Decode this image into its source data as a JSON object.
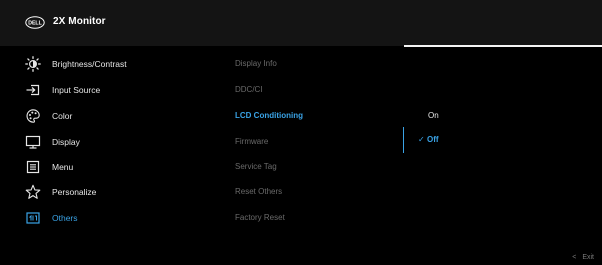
{
  "header": {
    "logo_text": "DELL",
    "title": "2X Monitor"
  },
  "menu": {
    "items": [
      {
        "label": "Brightness/Contrast",
        "icon": "brightness-icon"
      },
      {
        "label": "Input Source",
        "icon": "input-source-icon"
      },
      {
        "label": "Color",
        "icon": "color-palette-icon"
      },
      {
        "label": "Display",
        "icon": "display-icon"
      },
      {
        "label": "Menu",
        "icon": "menu-icon"
      },
      {
        "label": "Personalize",
        "icon": "star-icon"
      },
      {
        "label": "Others",
        "icon": "others-icon",
        "active": true
      }
    ]
  },
  "submenu": {
    "items": [
      "Display Info",
      "DDC/CI",
      "LCD Conditioning",
      "Firmware",
      "Service Tag",
      "Reset Others",
      "Factory Reset"
    ],
    "active": "LCD Conditioning"
  },
  "options": {
    "on_label": "On",
    "off_label": "Off",
    "selected": "Off"
  },
  "footer": {
    "exit_label": "Exit"
  },
  "colors": {
    "accent": "#3aa3e6",
    "background": "#000000",
    "header": "#141414",
    "text": "#e6e6e6",
    "muted": "#6a6a6a"
  }
}
